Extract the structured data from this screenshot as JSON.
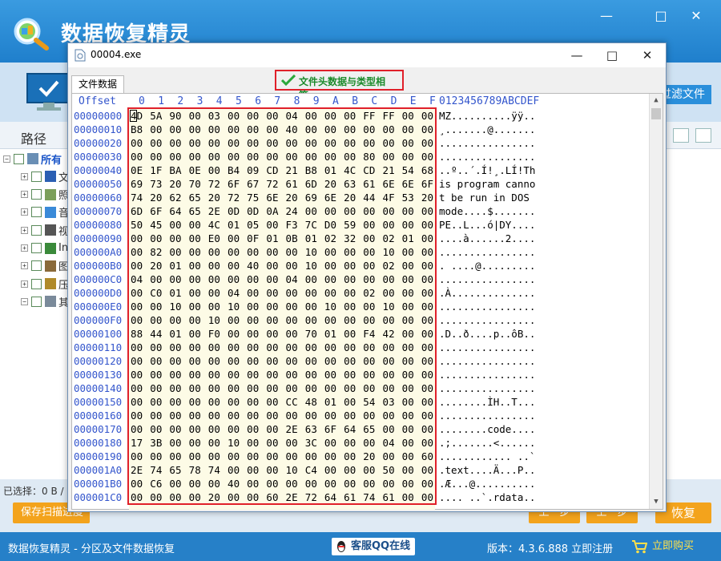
{
  "app": {
    "title": "数据恢复精灵",
    "win_min": "—",
    "win_max": "□",
    "win_close": "✕",
    "filter_button": "过滤文件",
    "path_label": "路径",
    "tree": [
      {
        "label": "所有",
        "expander": "−",
        "icon": "drive-icon"
      },
      {
        "label": "文",
        "expander": "+",
        "icon": "word-icon"
      },
      {
        "label": "照",
        "expander": "+",
        "icon": "image-icon"
      },
      {
        "label": "音",
        "expander": "+",
        "icon": "music-icon"
      },
      {
        "label": "视",
        "expander": "+",
        "icon": "video-icon"
      },
      {
        "label": "In",
        "expander": "+",
        "icon": "internet-icon"
      },
      {
        "label": "图",
        "expander": "+",
        "icon": "picture-icon"
      },
      {
        "label": "压",
        "expander": "+",
        "icon": "archive-icon"
      },
      {
        "label": "其",
        "expander": "−",
        "icon": "other-icon"
      }
    ],
    "selection_status": "已选择：0 B / 0",
    "save_progress_button": "保存扫描进度",
    "bottom_button_1": "上一步",
    "bottom_button_2": "上一步",
    "recover_button": "恢复",
    "status_text": "数据恢复精灵 - 分区及文件数据恢复",
    "qq_button": "客服QQ在线",
    "version_text": "版本：4.3.6.888  立即注册",
    "buy_button": "立即购买"
  },
  "dialog": {
    "title": "00004.exe",
    "min": "—",
    "max": "□",
    "close": "✕",
    "tab_label": "文件数据",
    "match_message": "文件头数据与类型相符。",
    "offset_header": "Offset",
    "hex_header": [
      "0",
      "1",
      "2",
      "3",
      "4",
      "5",
      "6",
      "7",
      "8",
      "9",
      "A",
      "B",
      "C",
      "D",
      "E",
      "F"
    ],
    "ascii_header": "0123456789ABCDEF",
    "scroll_up": "▲",
    "scroll_down": "▼",
    "rows": [
      {
        "offset": "00000000",
        "hex": [
          "4D",
          "5A",
          "90",
          "00",
          "03",
          "00",
          "00",
          "00",
          "04",
          "00",
          "00",
          "00",
          "FF",
          "FF",
          "00",
          "00"
        ],
        "ascii": "MZ..........ÿÿ.."
      },
      {
        "offset": "00000010",
        "hex": [
          "B8",
          "00",
          "00",
          "00",
          "00",
          "00",
          "00",
          "00",
          "40",
          "00",
          "00",
          "00",
          "00",
          "00",
          "00",
          "00"
        ],
        "ascii": "¸.......@......."
      },
      {
        "offset": "00000020",
        "hex": [
          "00",
          "00",
          "00",
          "00",
          "00",
          "00",
          "00",
          "00",
          "00",
          "00",
          "00",
          "00",
          "00",
          "00",
          "00",
          "00"
        ],
        "ascii": "................"
      },
      {
        "offset": "00000030",
        "hex": [
          "00",
          "00",
          "00",
          "00",
          "00",
          "00",
          "00",
          "00",
          "00",
          "00",
          "00",
          "00",
          "80",
          "00",
          "00",
          "00"
        ],
        "ascii": "................"
      },
      {
        "offset": "00000040",
        "hex": [
          "0E",
          "1F",
          "BA",
          "0E",
          "00",
          "B4",
          "09",
          "CD",
          "21",
          "B8",
          "01",
          "4C",
          "CD",
          "21",
          "54",
          "68"
        ],
        "ascii": "..º..´.Í!¸.LÍ!Th"
      },
      {
        "offset": "00000050",
        "hex": [
          "69",
          "73",
          "20",
          "70",
          "72",
          "6F",
          "67",
          "72",
          "61",
          "6D",
          "20",
          "63",
          "61",
          "6E",
          "6E",
          "6F"
        ],
        "ascii": "is program canno"
      },
      {
        "offset": "00000060",
        "hex": [
          "74",
          "20",
          "62",
          "65",
          "20",
          "72",
          "75",
          "6E",
          "20",
          "69",
          "6E",
          "20",
          "44",
          "4F",
          "53",
          "20"
        ],
        "ascii": "t be run in DOS "
      },
      {
        "offset": "00000070",
        "hex": [
          "6D",
          "6F",
          "64",
          "65",
          "2E",
          "0D",
          "0D",
          "0A",
          "24",
          "00",
          "00",
          "00",
          "00",
          "00",
          "00",
          "00"
        ],
        "ascii": "mode....$......."
      },
      {
        "offset": "00000080",
        "hex": [
          "50",
          "45",
          "00",
          "00",
          "4C",
          "01",
          "05",
          "00",
          "F3",
          "7C",
          "D0",
          "59",
          "00",
          "00",
          "00",
          "00"
        ],
        "ascii": "PE..L...ó|DY...."
      },
      {
        "offset": "00000090",
        "hex": [
          "00",
          "00",
          "00",
          "00",
          "E0",
          "00",
          "0F",
          "01",
          "0B",
          "01",
          "02",
          "32",
          "00",
          "02",
          "01",
          "00"
        ],
        "ascii": "....à......2...."
      },
      {
        "offset": "000000A0",
        "hex": [
          "00",
          "82",
          "00",
          "00",
          "00",
          "00",
          "00",
          "00",
          "00",
          "10",
          "00",
          "00",
          "00",
          "10",
          "00",
          "00"
        ],
        "ascii": "................"
      },
      {
        "offset": "000000B0",
        "hex": [
          "00",
          "20",
          "01",
          "00",
          "00",
          "00",
          "40",
          "00",
          "00",
          "10",
          "00",
          "00",
          "00",
          "02",
          "00",
          "00"
        ],
        "ascii": ". ....@........."
      },
      {
        "offset": "000000C0",
        "hex": [
          "04",
          "00",
          "00",
          "00",
          "00",
          "00",
          "00",
          "00",
          "04",
          "00",
          "00",
          "00",
          "00",
          "00",
          "00",
          "00"
        ],
        "ascii": "................"
      },
      {
        "offset": "000000D0",
        "hex": [
          "00",
          "C0",
          "01",
          "00",
          "00",
          "04",
          "00",
          "00",
          "00",
          "00",
          "00",
          "00",
          "02",
          "00",
          "00",
          "00"
        ],
        "ascii": ".À.............."
      },
      {
        "offset": "000000E0",
        "hex": [
          "00",
          "00",
          "10",
          "00",
          "00",
          "10",
          "00",
          "00",
          "00",
          "00",
          "10",
          "00",
          "00",
          "10",
          "00",
          "00"
        ],
        "ascii": "................"
      },
      {
        "offset": "000000F0",
        "hex": [
          "00",
          "00",
          "00",
          "00",
          "10",
          "00",
          "00",
          "00",
          "00",
          "00",
          "00",
          "00",
          "00",
          "00",
          "00",
          "00"
        ],
        "ascii": "................"
      },
      {
        "offset": "00000100",
        "hex": [
          "88",
          "44",
          "01",
          "00",
          "F0",
          "00",
          "00",
          "00",
          "00",
          "70",
          "01",
          "00",
          "F4",
          "42",
          "00",
          "00"
        ],
        "ascii": ".D..ð....p..ôB.."
      },
      {
        "offset": "00000110",
        "hex": [
          "00",
          "00",
          "00",
          "00",
          "00",
          "00",
          "00",
          "00",
          "00",
          "00",
          "00",
          "00",
          "00",
          "00",
          "00",
          "00"
        ],
        "ascii": "................"
      },
      {
        "offset": "00000120",
        "hex": [
          "00",
          "00",
          "00",
          "00",
          "00",
          "00",
          "00",
          "00",
          "00",
          "00",
          "00",
          "00",
          "00",
          "00",
          "00",
          "00"
        ],
        "ascii": "................"
      },
      {
        "offset": "00000130",
        "hex": [
          "00",
          "00",
          "00",
          "00",
          "00",
          "00",
          "00",
          "00",
          "00",
          "00",
          "00",
          "00",
          "00",
          "00",
          "00",
          "00"
        ],
        "ascii": "................"
      },
      {
        "offset": "00000140",
        "hex": [
          "00",
          "00",
          "00",
          "00",
          "00",
          "00",
          "00",
          "00",
          "00",
          "00",
          "00",
          "00",
          "00",
          "00",
          "00",
          "00"
        ],
        "ascii": "................"
      },
      {
        "offset": "00000150",
        "hex": [
          "00",
          "00",
          "00",
          "00",
          "00",
          "00",
          "00",
          "00",
          "CC",
          "48",
          "01",
          "00",
          "54",
          "03",
          "00",
          "00"
        ],
        "ascii": "........ÌH..T..."
      },
      {
        "offset": "00000160",
        "hex": [
          "00",
          "00",
          "00",
          "00",
          "00",
          "00",
          "00",
          "00",
          "00",
          "00",
          "00",
          "00",
          "00",
          "00",
          "00",
          "00"
        ],
        "ascii": "................"
      },
      {
        "offset": "00000170",
        "hex": [
          "00",
          "00",
          "00",
          "00",
          "00",
          "00",
          "00",
          "00",
          "2E",
          "63",
          "6F",
          "64",
          "65",
          "00",
          "00",
          "00"
        ],
        "ascii": "........code...."
      },
      {
        "offset": "00000180",
        "hex": [
          "17",
          "3B",
          "00",
          "00",
          "00",
          "10",
          "00",
          "00",
          "00",
          "3C",
          "00",
          "00",
          "00",
          "04",
          "00",
          "00"
        ],
        "ascii": ".;.......<......"
      },
      {
        "offset": "00000190",
        "hex": [
          "00",
          "00",
          "00",
          "00",
          "00",
          "00",
          "00",
          "00",
          "00",
          "00",
          "00",
          "00",
          "20",
          "00",
          "00",
          "60"
        ],
        "ascii": "............ ..`"
      },
      {
        "offset": "000001A0",
        "hex": [
          "2E",
          "74",
          "65",
          "78",
          "74",
          "00",
          "00",
          "00",
          "10",
          "C4",
          "00",
          "00",
          "00",
          "50",
          "00",
          "00"
        ],
        "ascii": ".text....Ä...P.."
      },
      {
        "offset": "000001B0",
        "hex": [
          "00",
          "C6",
          "00",
          "00",
          "00",
          "40",
          "00",
          "00",
          "00",
          "00",
          "00",
          "00",
          "00",
          "00",
          "00",
          "00"
        ],
        "ascii": ".Æ...@.........."
      },
      {
        "offset": "000001C0",
        "hex": [
          "00",
          "00",
          "00",
          "00",
          "20",
          "00",
          "00",
          "60",
          "2E",
          "72",
          "64",
          "61",
          "74",
          "61",
          "00",
          "00"
        ],
        "ascii": ".... ..`.rdata.."
      }
    ]
  },
  "colors": {
    "accent": "#2680c8",
    "highlight_border": "#e0202a",
    "offset_text": "#3355cc",
    "hex_background": "#fdfbe6",
    "button_orange": "#f3a31c"
  }
}
